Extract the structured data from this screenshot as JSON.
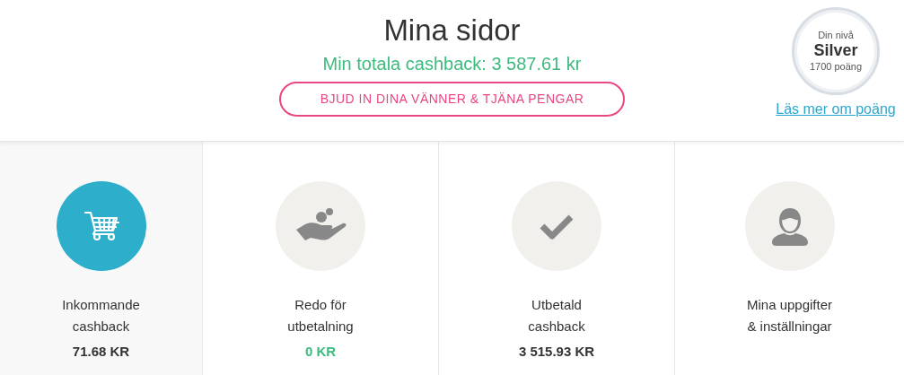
{
  "header": {
    "title": "Mina sidor",
    "total_cashback": "Min totala cashback: 3 587.61 kr",
    "invite_button": "BJUD IN DINA VÄNNER & TJÄNA PENGAR"
  },
  "level_badge": {
    "caption": "Din nivå",
    "level": "Silver",
    "points": "1700 poäng",
    "link": "Läs mer om poäng"
  },
  "tiles": [
    {
      "kind": "cart",
      "selected": true,
      "label": "Inkommande\ncashback",
      "amount": "71.68 KR",
      "highlighted": false
    },
    {
      "kind": "coins",
      "selected": false,
      "label": "Redo för\nutbetalning",
      "amount": "0 KR",
      "highlighted": true
    },
    {
      "kind": "check",
      "selected": false,
      "label": "Utbetald\ncashback",
      "amount": "3 515.93 KR",
      "highlighted": false
    },
    {
      "kind": "user",
      "selected": false,
      "label": "Mina uppgifter\n& inställningar"
    }
  ]
}
